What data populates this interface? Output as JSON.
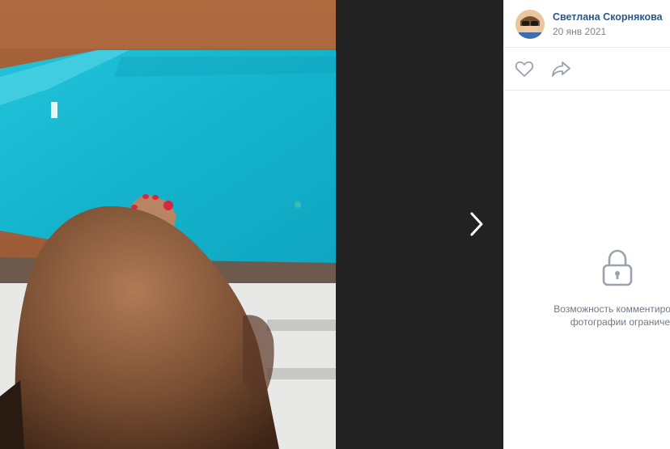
{
  "post": {
    "author_name": "Светлана Скорнякова",
    "date": "20 янв 2021"
  },
  "actions": {
    "like_icon": "heart-icon",
    "share_icon": "share-arrow-icon"
  },
  "comments": {
    "icon": "lock-icon",
    "restricted_line1": "Возможность комментирования",
    "restricted_line2": "фотографии ограничена"
  },
  "viewer": {
    "next_icon": "chevron-right-icon"
  },
  "colors": {
    "link": "#2a5885",
    "muted": "#828282",
    "viewer_bg": "#222222",
    "pool": "#17b6cf"
  }
}
